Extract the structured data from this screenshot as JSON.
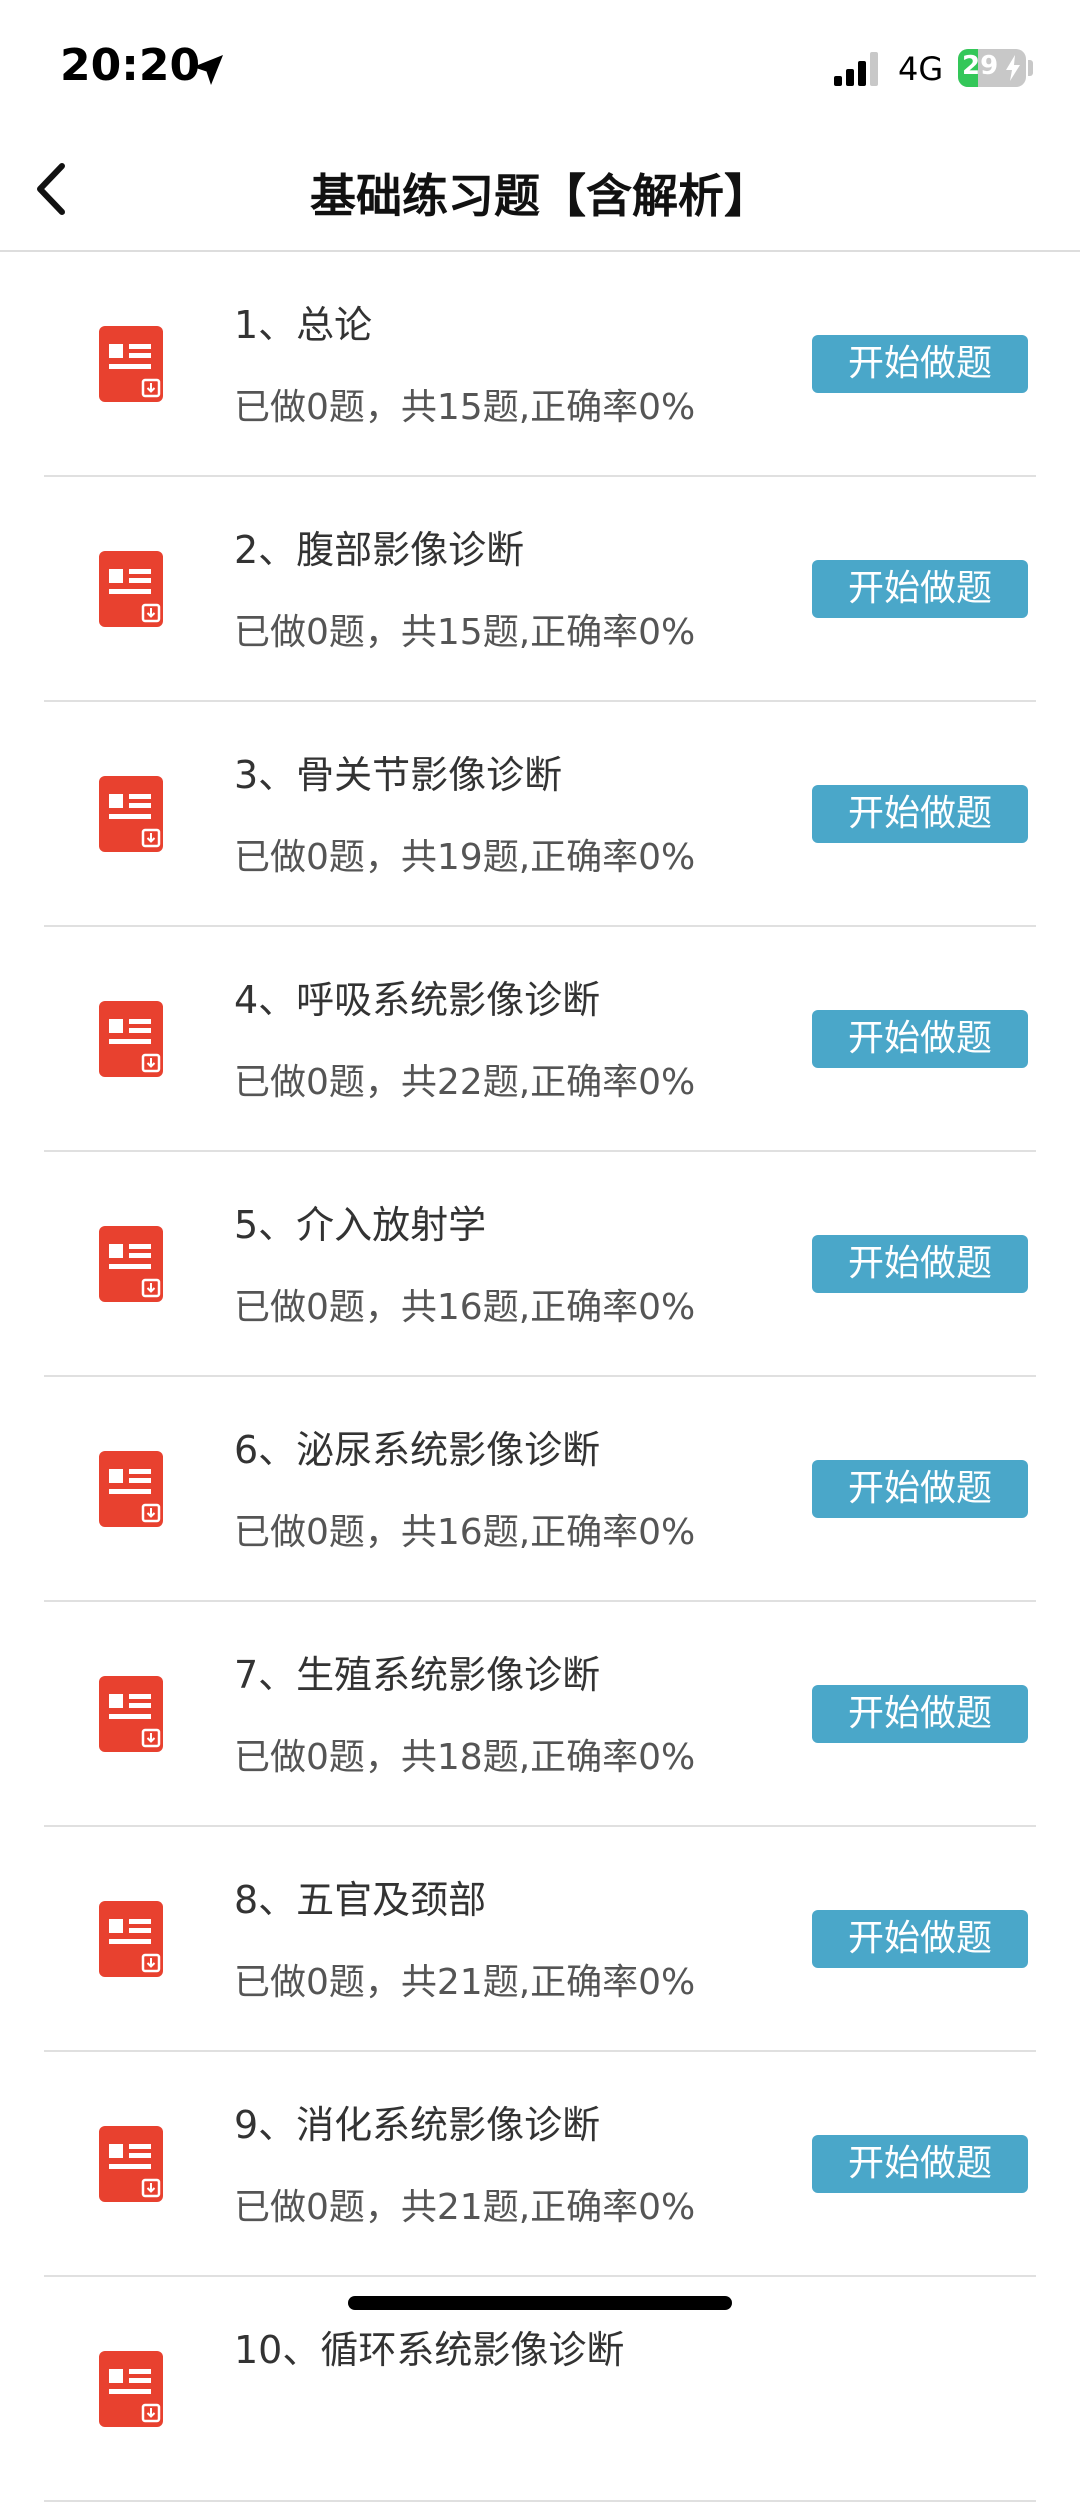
{
  "status_bar": {
    "time": "20:20",
    "network": "4G",
    "battery_level": "29",
    "battery_fraction": 0.29
  },
  "nav": {
    "title": "基础练习题【含解析】"
  },
  "items": [
    {
      "title": "1、总论",
      "stats": "已做0题，共15题,正确率0%",
      "button": "开始做题"
    },
    {
      "title": "2、腹部影像诊断",
      "stats": "已做0题，共15题,正确率0%",
      "button": "开始做题"
    },
    {
      "title": "3、骨关节影像诊断",
      "stats": "已做0题，共19题,正确率0%",
      "button": "开始做题"
    },
    {
      "title": "4、呼吸系统影像诊断",
      "stats": "已做0题，共22题,正确率0%",
      "button": "开始做题"
    },
    {
      "title": "5、介入放射学",
      "stats": "已做0题，共16题,正确率0%",
      "button": "开始做题"
    },
    {
      "title": "6、泌尿系统影像诊断",
      "stats": "已做0题，共16题,正确率0%",
      "button": "开始做题"
    },
    {
      "title": "7、生殖系统影像诊断",
      "stats": "已做0题，共18题,正确率0%",
      "button": "开始做题"
    },
    {
      "title": "8、五官及颈部",
      "stats": "已做0题，共21题,正确率0%",
      "button": "开始做题"
    },
    {
      "title": "9、消化系统影像诊断",
      "stats": "已做0题，共21题,正确率0%",
      "button": "开始做题"
    },
    {
      "title": "10、循环系统影像诊断",
      "stats": "",
      "button": ""
    }
  ],
  "icons": {
    "item_icon": "red-document-icon",
    "back": "chevron-left-icon"
  },
  "colors": {
    "accent": "#4aa7c9",
    "icon_red": "#e8412f"
  }
}
